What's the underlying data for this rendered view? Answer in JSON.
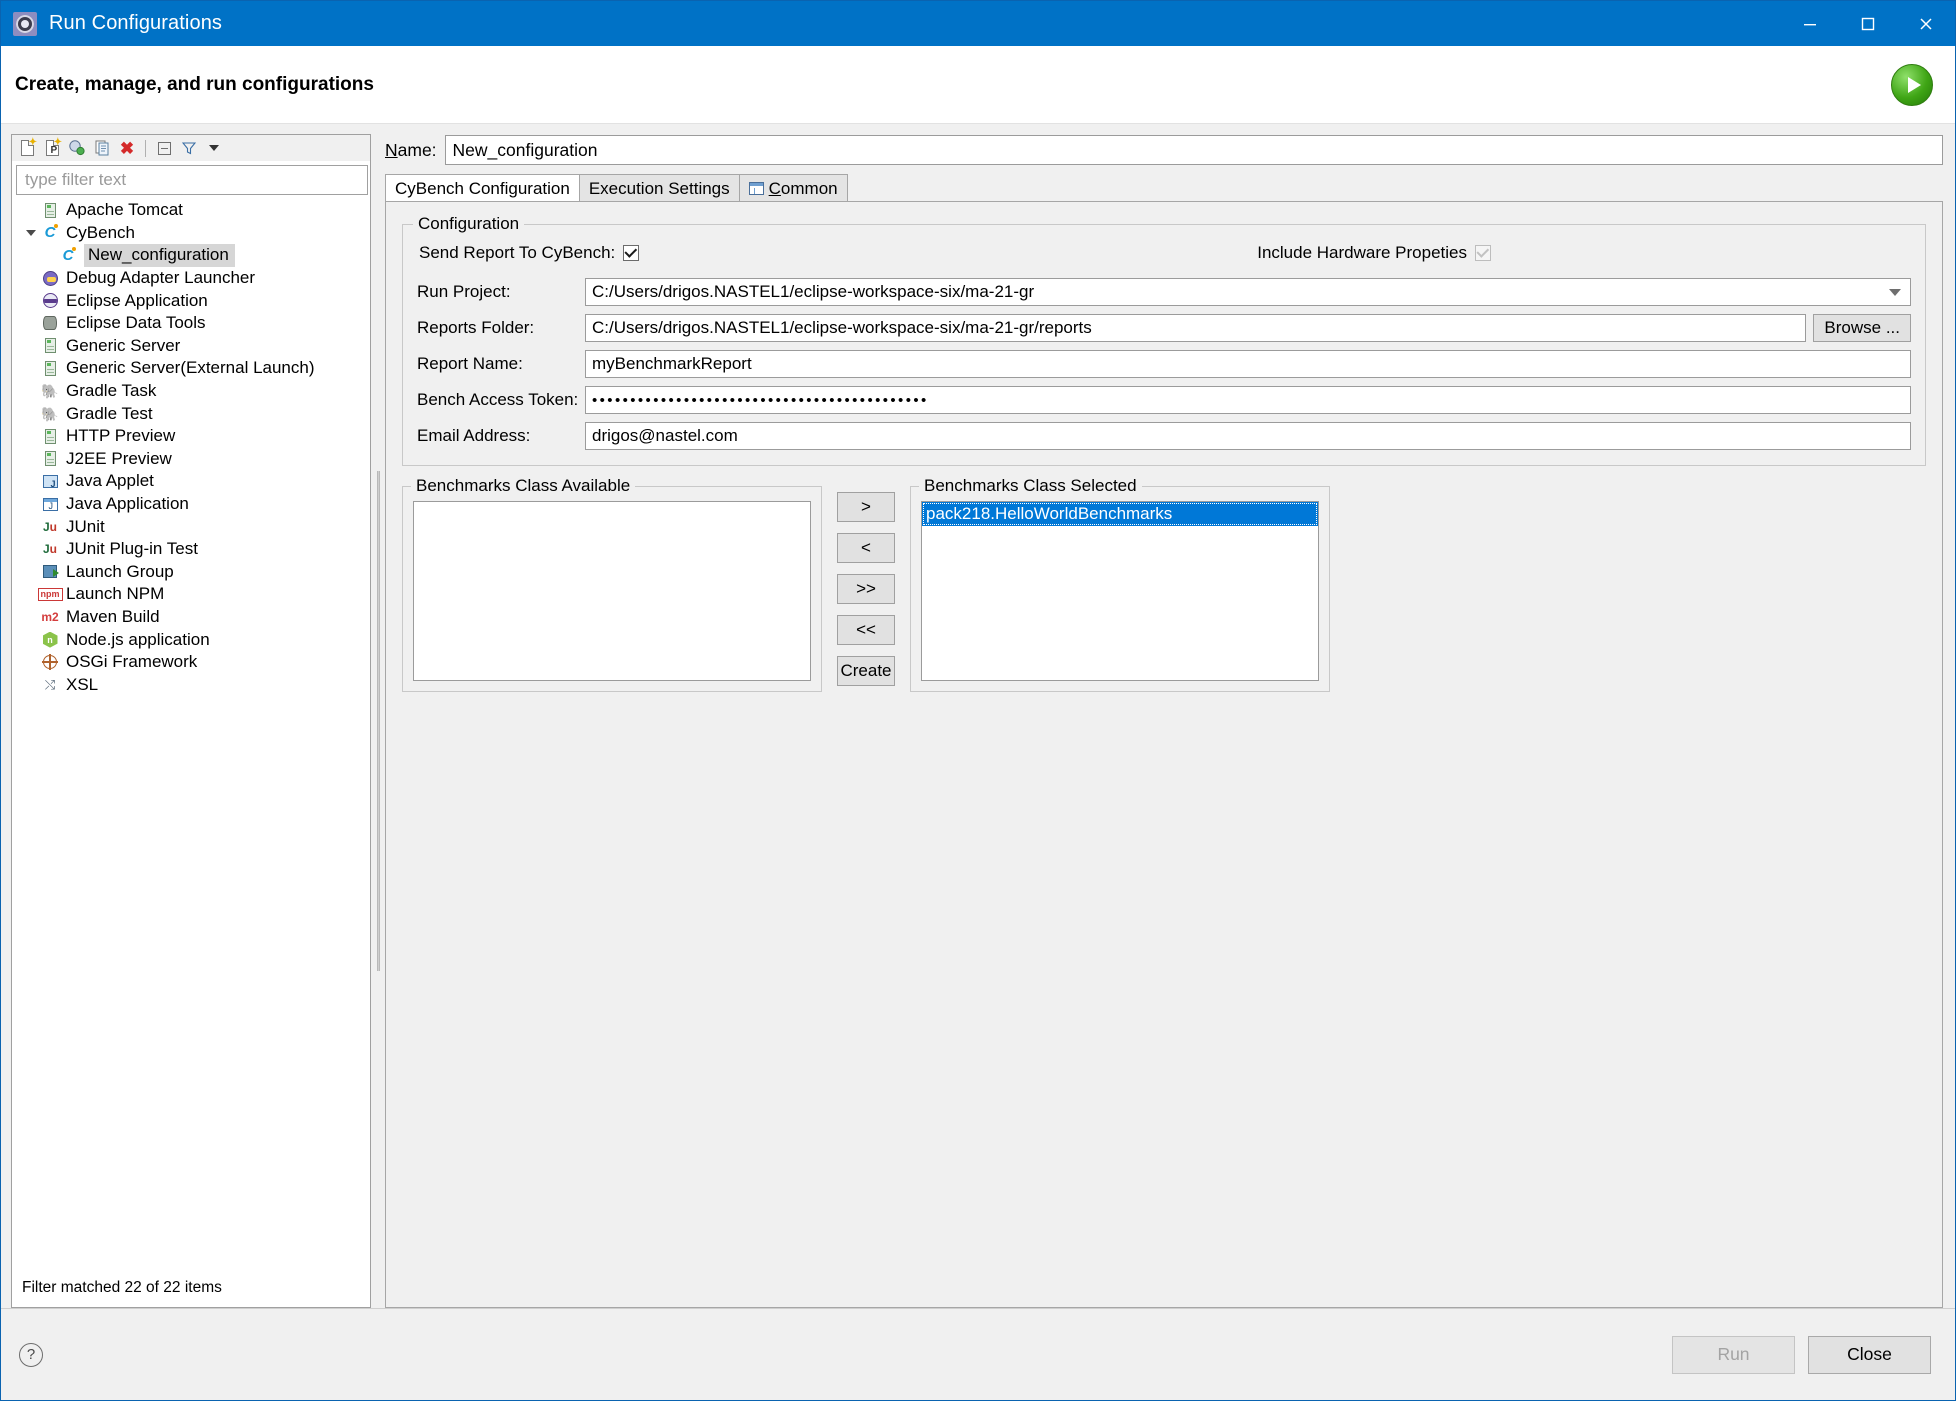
{
  "window": {
    "title": "Run Configurations",
    "icon": "run-configurations-gear-icon",
    "minimize": "minimize-icon",
    "maximize": "maximize-icon",
    "close": "close-icon"
  },
  "header": {
    "title": "Create, manage, and run configurations",
    "run_icon": "run-green-play-icon"
  },
  "toolbar": {
    "items": [
      {
        "name": "new-configuration-icon",
        "tip": "New launch configuration"
      },
      {
        "name": "new-prototype-icon",
        "tip": "New prototype"
      },
      {
        "name": "export-icon",
        "tip": "Export"
      },
      {
        "name": "duplicate-icon",
        "tip": "Duplicate"
      },
      {
        "name": "delete-icon",
        "tip": "Delete"
      },
      {
        "name": "collapse-all-icon",
        "tip": "Collapse All"
      },
      {
        "name": "filter-icon",
        "tip": "Filter launch configurations"
      },
      {
        "name": "view-menu-icon",
        "tip": "View Menu"
      }
    ]
  },
  "filter": {
    "placeholder": "type filter text",
    "value": ""
  },
  "tree": {
    "status": "Filter matched 22 of 22 items",
    "items": [
      {
        "label": "Apache Tomcat",
        "icon": "server-icon",
        "indent": 1,
        "twisty": "none",
        "selected": false
      },
      {
        "label": "CyBench",
        "icon": "cybench-icon",
        "indent": 0,
        "twisty": "expanded",
        "selected": false
      },
      {
        "label": "New_configuration",
        "icon": "cybench-icon",
        "indent": 2,
        "twisty": "none",
        "selected": true
      },
      {
        "label": "Debug Adapter Launcher",
        "icon": "debug-adapter-icon",
        "indent": 1,
        "twisty": "none",
        "selected": false
      },
      {
        "label": "Eclipse Application",
        "icon": "eclipse-icon",
        "indent": 1,
        "twisty": "none",
        "selected": false
      },
      {
        "label": "Eclipse Data Tools",
        "icon": "database-icon",
        "indent": 1,
        "twisty": "none",
        "selected": false
      },
      {
        "label": "Generic Server",
        "icon": "server-icon",
        "indent": 1,
        "twisty": "none",
        "selected": false
      },
      {
        "label": "Generic Server(External Launch)",
        "icon": "server-icon",
        "indent": 1,
        "twisty": "none",
        "selected": false
      },
      {
        "label": "Gradle Task",
        "icon": "gradle-elephant-icon",
        "indent": 1,
        "twisty": "none",
        "selected": false
      },
      {
        "label": "Gradle Test",
        "icon": "gradle-elephant-icon",
        "indent": 1,
        "twisty": "none",
        "selected": false
      },
      {
        "label": "HTTP Preview",
        "icon": "server-icon",
        "indent": 1,
        "twisty": "none",
        "selected": false
      },
      {
        "label": "J2EE Preview",
        "icon": "server-icon",
        "indent": 1,
        "twisty": "none",
        "selected": false
      },
      {
        "label": "Java Applet",
        "icon": "java-applet-icon",
        "indent": 1,
        "twisty": "none",
        "selected": false
      },
      {
        "label": "Java Application",
        "icon": "java-application-icon",
        "indent": 1,
        "twisty": "none",
        "selected": false
      },
      {
        "label": "JUnit",
        "icon": "junit-icon",
        "indent": 1,
        "twisty": "none",
        "selected": false
      },
      {
        "label": "JUnit Plug-in Test",
        "icon": "junit-plugin-icon",
        "indent": 1,
        "twisty": "none",
        "selected": false
      },
      {
        "label": "Launch Group",
        "icon": "launch-group-icon",
        "indent": 1,
        "twisty": "none",
        "selected": false
      },
      {
        "label": "Launch NPM",
        "icon": "npm-icon",
        "indent": 1,
        "twisty": "none",
        "selected": false
      },
      {
        "label": "Maven Build",
        "icon": "maven-icon",
        "indent": 1,
        "twisty": "none",
        "selected": false
      },
      {
        "label": "Node.js application",
        "icon": "nodejs-icon",
        "indent": 1,
        "twisty": "none",
        "selected": false
      },
      {
        "label": "OSGi Framework",
        "icon": "osgi-icon",
        "indent": 1,
        "twisty": "none",
        "selected": false
      },
      {
        "label": "XSL",
        "icon": "xsl-icon",
        "indent": 1,
        "twisty": "none",
        "selected": false
      }
    ]
  },
  "name_field": {
    "label_pre": "",
    "label_mnemonic": "N",
    "label_post": "ame:",
    "value": "New_configuration"
  },
  "tabs": [
    {
      "label": "CyBench Configuration",
      "active": true,
      "icon": null
    },
    {
      "label": "Execution Settings",
      "active": false,
      "icon": null
    },
    {
      "label": "Common",
      "active": false,
      "icon": "common-tab-icon",
      "mnemonic": "C",
      "rest": "ommon"
    }
  ],
  "configuration": {
    "group_title": "Configuration",
    "send_report_label": "Send Report To CyBench:",
    "send_report_checked": true,
    "include_hardware_label": "Include Hardware Propeties",
    "include_hardware_checked": true,
    "include_hardware_disabled": true,
    "fields": [
      {
        "label": "Run Project:",
        "value": "C:/Users/drigos.NASTEL1/eclipse-workspace-six/ma-21-gr",
        "type": "combo"
      },
      {
        "label": "Reports Folder:",
        "value": "C:/Users/drigos.NASTEL1/eclipse-workspace-six/ma-21-gr/reports",
        "type": "text-with-button",
        "button": "Browse ..."
      },
      {
        "label": "Report Name:",
        "value": "myBenchmarkReport",
        "type": "text"
      },
      {
        "label": "Bench Access Token:",
        "value": "••••••••••••••••••••••••••••••••••••••••••••",
        "type": "password"
      },
      {
        "label": "Email Address:",
        "value": "drigos@nastel.com",
        "type": "text"
      }
    ]
  },
  "benchmarks": {
    "available_title": "Benchmarks Class Available",
    "selected_title": "Benchmarks Class Selected",
    "available_items": [],
    "selected_items": [
      "pack218.HelloWorldBenchmarks"
    ],
    "buttons": [
      ">",
      "<",
      ">>",
      "<<",
      "Create"
    ]
  },
  "footer": {
    "help_icon": "help-question-icon",
    "run_label": "Run",
    "run_disabled": true,
    "close_label": "Close"
  },
  "colors": {
    "titlebar": "#0072c6",
    "selection": "#0078d7",
    "tree_selection": "#d6d6d6",
    "dialog_bg": "#f0f0f0"
  }
}
